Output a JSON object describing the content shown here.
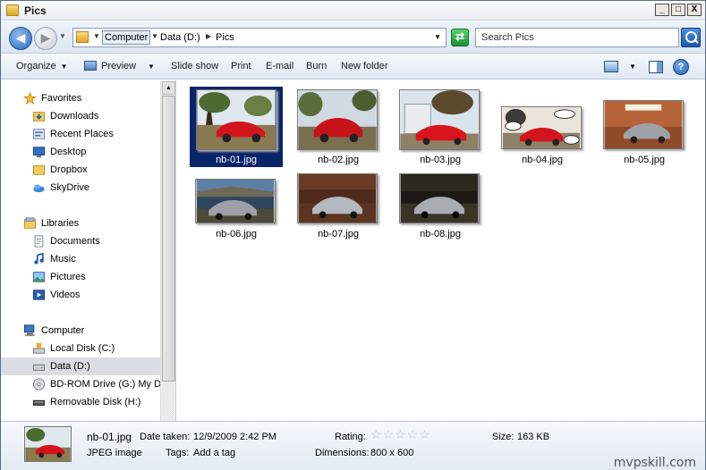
{
  "window": {
    "title": "Pics",
    "controls": [
      "_",
      "□",
      "X"
    ]
  },
  "address": {
    "segments": [
      "Computer",
      "Data (D:)",
      "Pics"
    ]
  },
  "search": {
    "placeholder": "Search Pics"
  },
  "toolbar": {
    "organize": "Organize",
    "preview": "Preview",
    "slideshow": "Slide show",
    "print": "Print",
    "email": "E-mail",
    "burn": "Burn",
    "new_folder": "New folder"
  },
  "nav": {
    "favorites": "Favorites",
    "downloads": "Downloads",
    "recent": "Recent Places",
    "desktop": "Desktop",
    "dropbox": "Dropbox",
    "skydrive": "SkyDrive",
    "libraries": "Libraries",
    "documents": "Documents",
    "music": "Music",
    "pictures": "Pictures",
    "videos": "Videos",
    "computer": "Computer",
    "local_disk": "Local Disk (C:)",
    "data": "Data (D:)",
    "bdrom": "BD-ROM Drive (G:) My Dis",
    "removable": "Removable Disk (H:)"
  },
  "files": [
    {
      "name": "nb-01.jpg",
      "selected": true
    },
    {
      "name": "nb-02.jpg",
      "selected": false
    },
    {
      "name": "nb-03.jpg",
      "selected": false
    },
    {
      "name": "nb-04.jpg",
      "selected": false
    },
    {
      "name": "nb-05.jpg",
      "selected": false
    },
    {
      "name": "nb-06.jpg",
      "selected": false
    },
    {
      "name": "nb-07.jpg",
      "selected": false
    },
    {
      "name": "nb-08.jpg",
      "selected": false
    }
  ],
  "details": {
    "name": "nb-01.jpg",
    "type": "JPEG image",
    "date_label": "Date taken:",
    "date_value": "12/9/2009 2:42 PM",
    "tags_label": "Tags:",
    "tags_value": "Add a tag",
    "rating_label": "Rating:",
    "rating_value": 0,
    "dimensions_label": "Dimensions:",
    "dimensions_value": "800 x 600",
    "size_label": "Size:",
    "size_value": "163 KB"
  },
  "watermark": "mvpskill.com"
}
